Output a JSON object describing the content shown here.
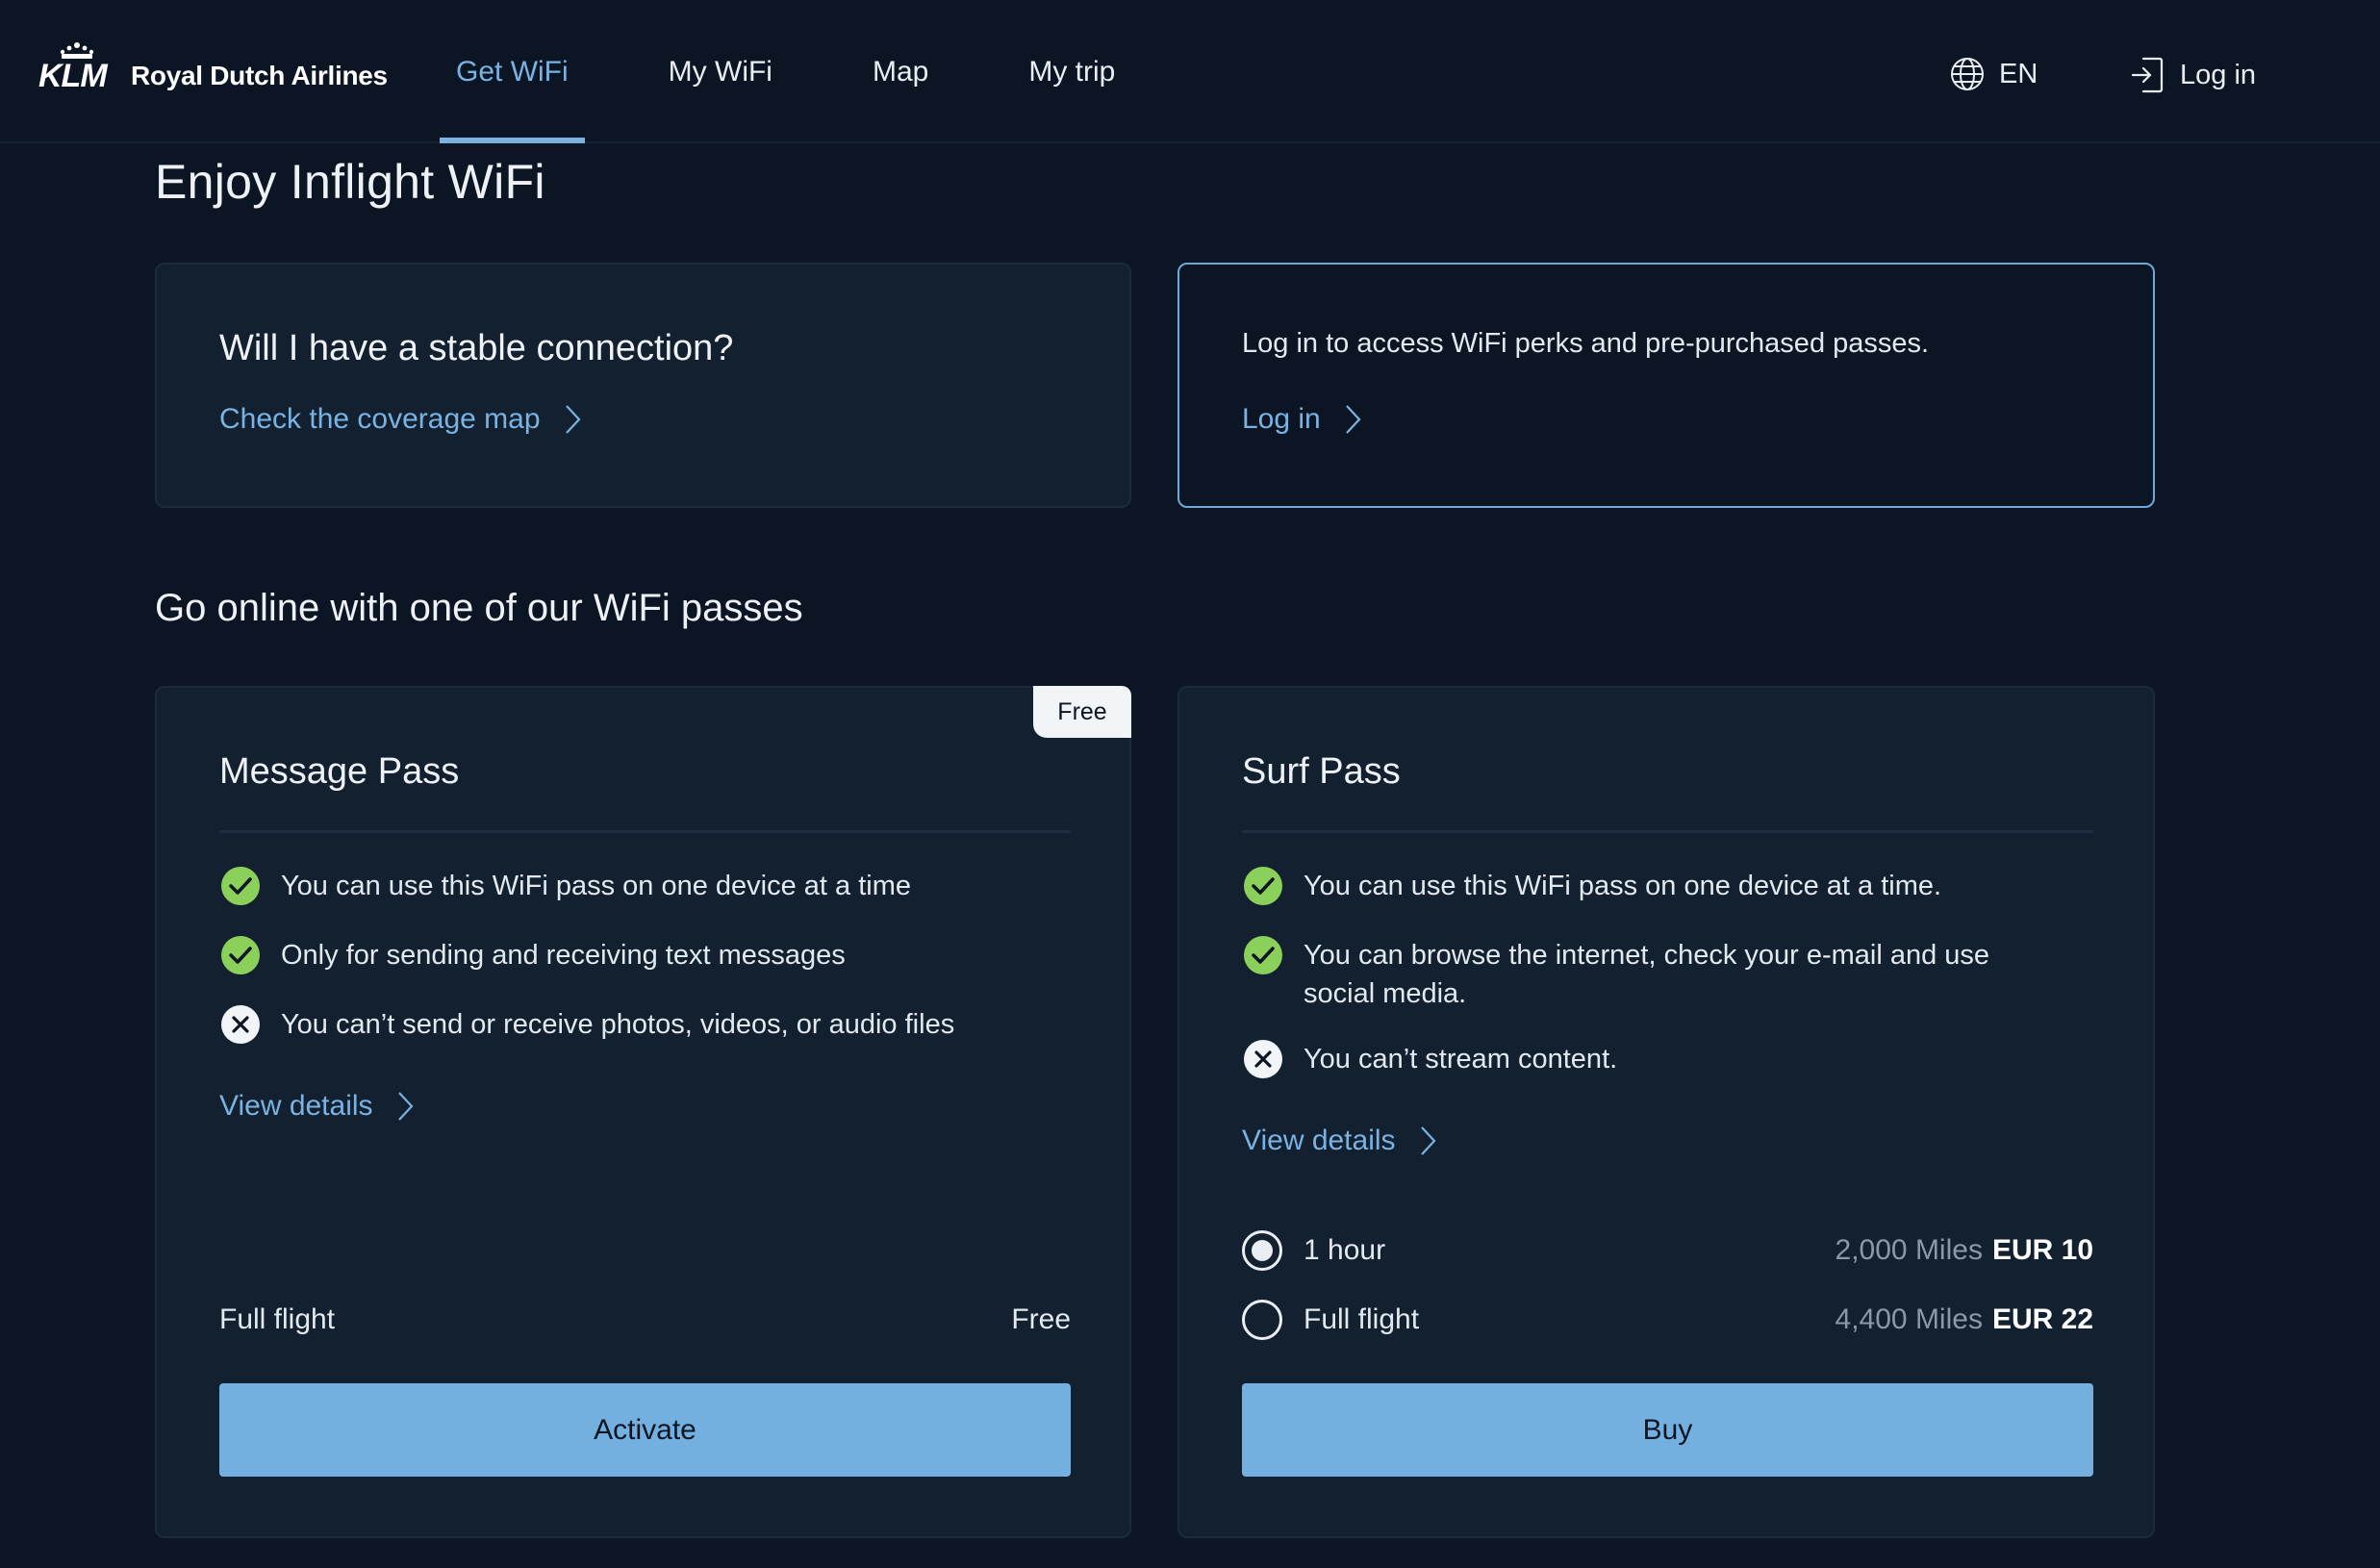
{
  "header": {
    "logo_wordmark": "KLM",
    "logo_text": "Royal Dutch Airlines",
    "nav": [
      {
        "label": "Get WiFi",
        "active": true
      },
      {
        "label": "My WiFi",
        "active": false
      },
      {
        "label": "Map",
        "active": false
      },
      {
        "label": "My trip",
        "active": false
      }
    ],
    "language": "EN",
    "login_label": "Log in"
  },
  "page": {
    "title": "Enjoy Inflight WiFi"
  },
  "coverage_card": {
    "heading": "Will I have a stable connection?",
    "link_label": "Check the coverage map"
  },
  "login_card": {
    "text": "Log in to access WiFi perks and pre-purchased passes.",
    "link_label": "Log in"
  },
  "passes_section": {
    "title": "Go online with one of our WiFi passes"
  },
  "message_pass": {
    "badge": "Free",
    "name": "Message Pass",
    "features": [
      {
        "icon": "check-icon",
        "included": true,
        "text": "You can use this WiFi pass on one device at a time"
      },
      {
        "icon": "check-icon",
        "included": true,
        "text": "Only for sending and receiving text messages"
      },
      {
        "icon": "cross-icon",
        "included": false,
        "text": "You can’t send or receive photos, videos, or audio files"
      }
    ],
    "details_label": "View details",
    "duration_label": "Full flight",
    "price_label": "Free",
    "button_label": "Activate"
  },
  "surf_pass": {
    "name": "Surf Pass",
    "features": [
      {
        "icon": "check-icon",
        "included": true,
        "text": "You can use this WiFi pass on one device at a time."
      },
      {
        "icon": "check-icon",
        "included": true,
        "text": "You can browse the internet, check your e-mail and use social media."
      },
      {
        "icon": "cross-icon",
        "included": false,
        "text": "You can’t stream content."
      }
    ],
    "details_label": "View details",
    "options": [
      {
        "label": "1 hour",
        "miles": "2,000 Miles",
        "price": "EUR 10",
        "selected": true
      },
      {
        "label": "Full flight",
        "miles": "4,400 Miles",
        "price": "EUR 22",
        "selected": false
      }
    ],
    "button_label": "Buy"
  },
  "colors": {
    "background": "#0b1523",
    "card": "#122030",
    "accent": "#7ab3e2",
    "button": "#74b0df",
    "success": "#8bd05a"
  }
}
